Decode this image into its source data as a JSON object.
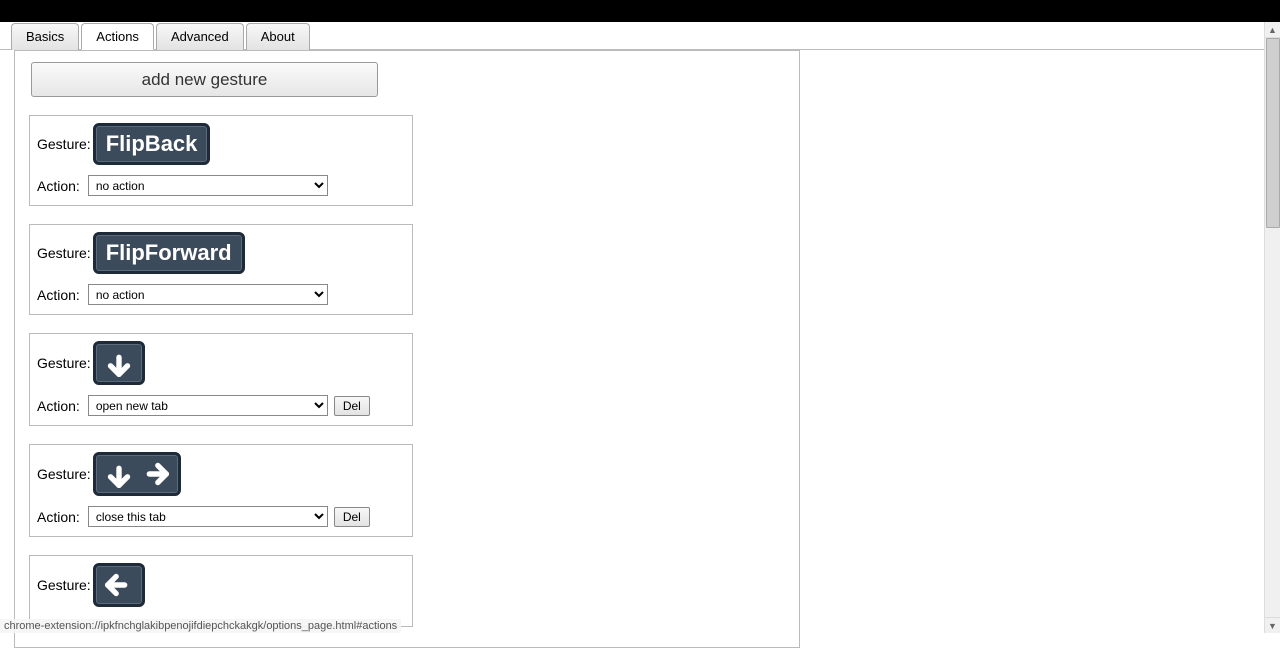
{
  "tabs": [
    {
      "label": "Basics",
      "active": false
    },
    {
      "label": "Actions",
      "active": true
    },
    {
      "label": "Advanced",
      "active": false
    },
    {
      "label": "About",
      "active": false
    }
  ],
  "add_button_label": "add new gesture",
  "labels": {
    "gesture": "Gesture:",
    "action": "Action:",
    "del": "Del"
  },
  "action_options": [
    "no action",
    "open new tab",
    "close this tab"
  ],
  "gestures": [
    {
      "type": "text",
      "text": "FlipBack",
      "action": "no action",
      "has_del": false
    },
    {
      "type": "text",
      "text": "FlipForward",
      "action": "no action",
      "has_del": false
    },
    {
      "type": "arrows",
      "arrows": [
        "down"
      ],
      "action": "open new tab",
      "has_del": true
    },
    {
      "type": "arrows",
      "arrows": [
        "down",
        "right"
      ],
      "action": "close this tab",
      "has_del": true
    },
    {
      "type": "arrows",
      "arrows": [
        "left"
      ],
      "action": "",
      "has_del": false,
      "action_row_hidden": true
    }
  ],
  "status_url": "chrome-extension://ipkfnchglakibpenojifdiepchckakgk/options_page.html#actions"
}
